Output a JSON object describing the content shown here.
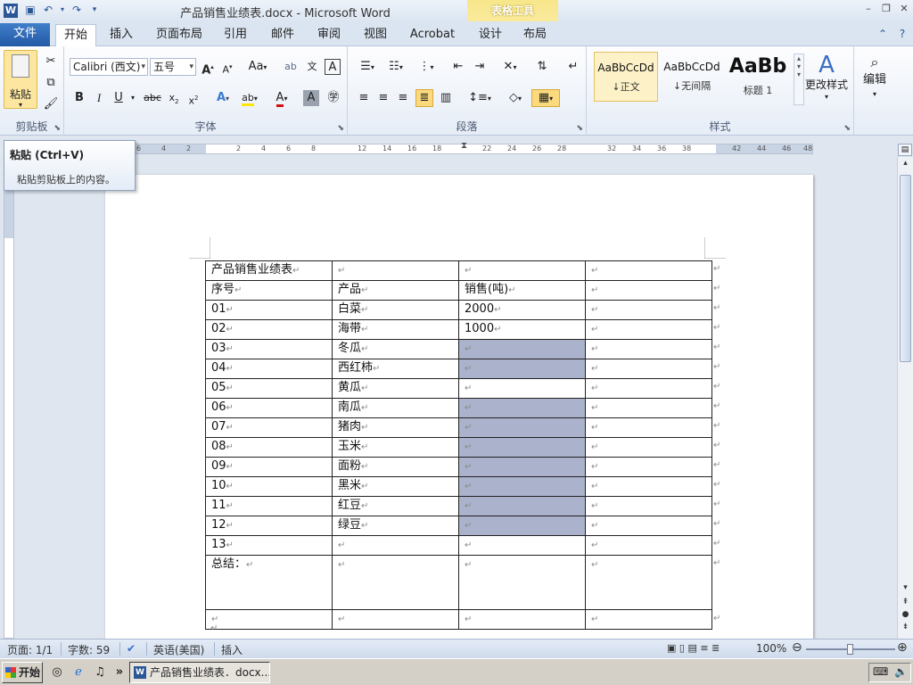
{
  "window": {
    "title": "产品销售业绩表.docx - Microsoft Word",
    "context_tab_title": "表格工具",
    "app_letter": "W"
  },
  "tabs": [
    "文件",
    "开始",
    "插入",
    "页面布局",
    "引用",
    "邮件",
    "审阅",
    "视图",
    "Acrobat",
    "设计",
    "布局"
  ],
  "ribbon": {
    "clipboard": {
      "label": "剪贴板",
      "paste": "粘贴"
    },
    "font": {
      "label": "字体",
      "font_name": "Calibri (西文)",
      "font_size": "五号"
    },
    "paragraph": {
      "label": "段落"
    },
    "styles": {
      "label": "样式",
      "items": [
        {
          "preview": "AaBbCcDd",
          "name": "↓正文"
        },
        {
          "preview": "AaBbCcDd",
          "name": "↓无间隔"
        },
        {
          "preview": "AaBb",
          "name": "标题 1"
        }
      ],
      "change_styles": "更改样式"
    },
    "editing": {
      "label": "编辑"
    }
  },
  "tooltip": {
    "title": "粘贴 (Ctrl+V)",
    "description": "粘贴剪贴板上的内容。"
  },
  "ruler": {
    "ticks": [
      "6",
      "4",
      "2",
      "2",
      "4",
      "6",
      "8",
      "12",
      "14",
      "16",
      "18",
      "22",
      "24",
      "26",
      "28",
      "32",
      "34",
      "36",
      "38",
      "42",
      "44",
      "46",
      "48"
    ]
  },
  "table": {
    "rows": [
      [
        "产品销售业绩表",
        "",
        "",
        ""
      ],
      [
        "序号",
        "产品",
        "销售(吨)",
        ""
      ],
      [
        "01",
        "白菜",
        "2000",
        ""
      ],
      [
        "02",
        "海带",
        "1000",
        ""
      ],
      [
        "03",
        "冬瓜",
        "",
        ""
      ],
      [
        "04",
        "西红柿",
        "",
        ""
      ],
      [
        "05",
        "黄瓜",
        "",
        ""
      ],
      [
        "06",
        "南瓜",
        "",
        ""
      ],
      [
        "07",
        "猪肉",
        "",
        ""
      ],
      [
        "08",
        "玉米",
        "",
        ""
      ],
      [
        "09",
        "面粉",
        "",
        ""
      ],
      [
        "10",
        "黑米",
        "",
        ""
      ],
      [
        "11",
        "红豆",
        "",
        ""
      ],
      [
        "12",
        "绿豆",
        "",
        ""
      ],
      [
        "13",
        "",
        "",
        ""
      ],
      [
        "总结：",
        "",
        "",
        ""
      ],
      [
        "",
        "",
        "",
        ""
      ]
    ],
    "shaded_cells": [
      [
        4,
        2
      ],
      [
        5,
        2
      ],
      [
        7,
        2
      ],
      [
        8,
        2
      ],
      [
        9,
        2
      ],
      [
        10,
        2
      ],
      [
        11,
        2
      ],
      [
        12,
        2
      ],
      [
        13,
        2
      ]
    ],
    "paragraph_mark": "↵",
    "shade_color": "#aab2cc"
  },
  "statusbar": {
    "page": "页面: 1/1",
    "words": "字数: 59",
    "language": "英语(美国)",
    "mode": "插入",
    "zoom": "100%"
  },
  "taskbar": {
    "start": "开始",
    "task_item": "产品销售业绩表．docx..."
  }
}
